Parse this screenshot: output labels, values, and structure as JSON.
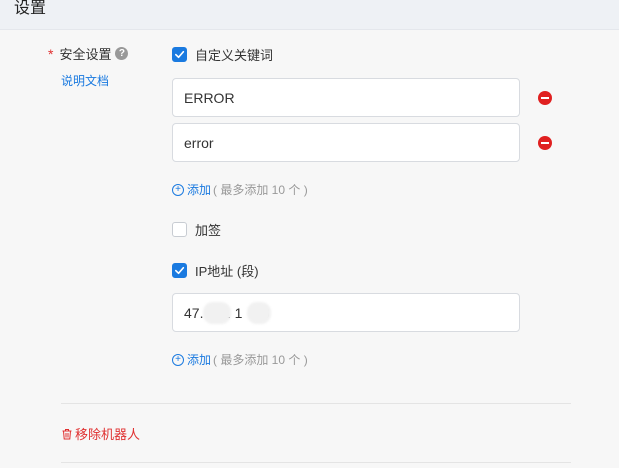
{
  "header": {
    "title": "设置"
  },
  "security": {
    "label": "安全设置",
    "required_mark": "*",
    "help_icon": "question-circle-icon",
    "doc_link": "说明文档"
  },
  "keywords": {
    "checkbox_label": "自定义关键词",
    "checked": true,
    "items": [
      "ERROR",
      "error"
    ],
    "add_label": "添加",
    "add_hint": "( 最多添加 10 个 )"
  },
  "sign": {
    "checkbox_label": "加签",
    "checked": false
  },
  "ip": {
    "checkbox_label": "IP地址 (段)",
    "checked": true,
    "items": [
      "47.     1 1     6"
    ],
    "add_label": "添加",
    "add_hint": "( 最多添加 10 个 )"
  },
  "footer": {
    "remove_robot_label": "移除机器人",
    "remove_icon": "trash-icon"
  },
  "colors": {
    "accent": "#1a7ae0",
    "danger": "#e03030",
    "header_bg": "#eef1f5"
  }
}
